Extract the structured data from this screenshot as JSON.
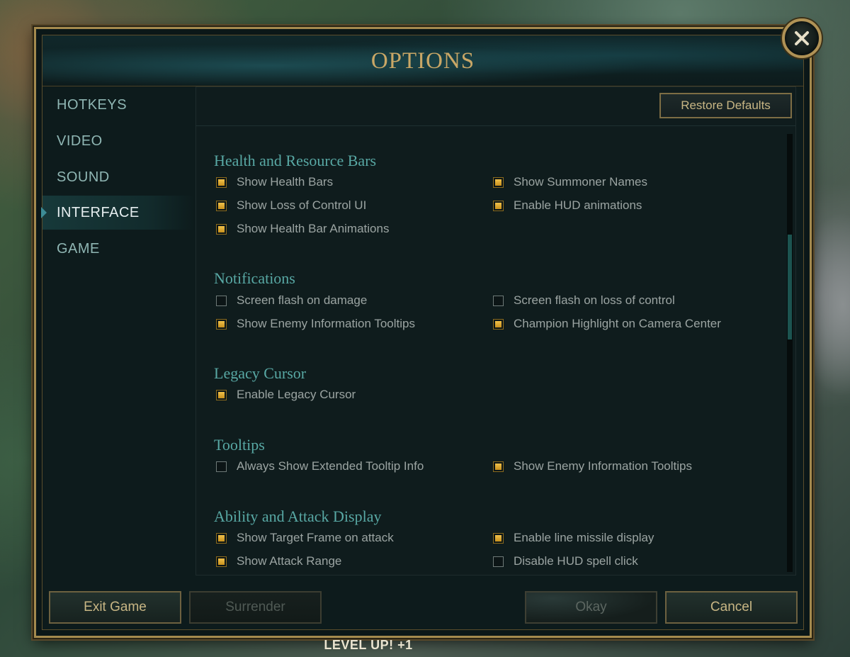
{
  "title": "OPTIONS",
  "sidebar": {
    "items": [
      {
        "label": "HOTKEYS",
        "active": false
      },
      {
        "label": "VIDEO",
        "active": false
      },
      {
        "label": "SOUND",
        "active": false
      },
      {
        "label": "INTERFACE",
        "active": true
      },
      {
        "label": "GAME",
        "active": false
      }
    ]
  },
  "panel": {
    "restore_label": "Restore Defaults",
    "sections": [
      {
        "title": "Health and Resource Bars",
        "options": [
          {
            "label": "Show Health Bars",
            "checked": true
          },
          {
            "label": "Show Summoner Names",
            "checked": true
          },
          {
            "label": "Show Loss of Control UI",
            "checked": true
          },
          {
            "label": "Enable HUD animations",
            "checked": true
          },
          {
            "label": "Show Health Bar Animations",
            "checked": true
          }
        ]
      },
      {
        "title": "Notifications",
        "options": [
          {
            "label": "Screen flash on damage",
            "checked": false
          },
          {
            "label": "Screen flash on loss of control",
            "checked": false
          },
          {
            "label": "Show Enemy Information Tooltips",
            "checked": true
          },
          {
            "label": "Champion Highlight on Camera Center",
            "checked": true
          }
        ]
      },
      {
        "title": "Legacy Cursor",
        "options": [
          {
            "label": "Enable Legacy Cursor",
            "checked": true
          }
        ]
      },
      {
        "title": "Tooltips",
        "options": [
          {
            "label": "Always Show Extended Tooltip Info",
            "checked": false
          },
          {
            "label": "Show Enemy Information Tooltips",
            "checked": true
          }
        ]
      },
      {
        "title": "Ability and Attack Display",
        "options": [
          {
            "label": "Show Target Frame on attack",
            "checked": true
          },
          {
            "label": "Enable line missile display",
            "checked": true
          },
          {
            "label": "Show Attack Range",
            "checked": true
          },
          {
            "label": "Disable HUD spell click",
            "checked": false
          }
        ]
      }
    ]
  },
  "footer": {
    "exit_label": "Exit Game",
    "surrender_label": "Surrender",
    "okay_label": "Okay",
    "cancel_label": "Cancel"
  },
  "hud": {
    "level_up": "LEVEL UP! +1"
  },
  "colors": {
    "accent_gold": "#c9a766",
    "section_teal": "#58a8a4",
    "checkbox_fill": "#f0c14b"
  },
  "icons": {
    "close": "close-icon",
    "nav_arrow": "arrow-right-icon"
  }
}
